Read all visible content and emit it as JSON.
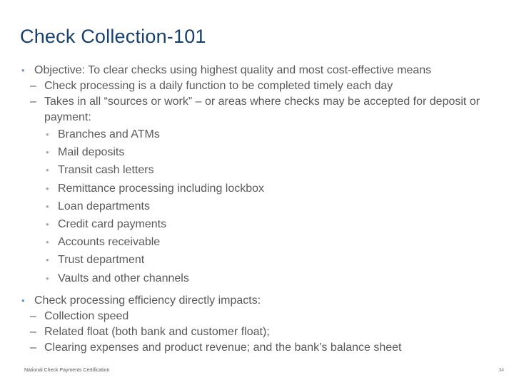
{
  "title": "Check Collection-101",
  "sections": [
    {
      "text": "Objective: To clear checks using highest quality and most cost-effective means",
      "sub": [
        {
          "text": "Check processing is a daily function to be completed timely each day"
        },
        {
          "text": "Takes in all “sources or work” – or areas where checks may be accepted for deposit or payment:",
          "items": [
            "Branches and ATMs",
            "Mail deposits",
            "Transit cash letters",
            "Remittance processing including lockbox",
            "Loan departments",
            "Credit card payments",
            "Accounts receivable",
            "Trust department",
            "Vaults and other channels"
          ]
        }
      ]
    },
    {
      "text": "Check processing efficiency directly impacts:",
      "sub": [
        {
          "text": "Collection speed"
        },
        {
          "text": "Related float (both bank and customer float);"
        },
        {
          "text": "Clearing expenses and product revenue; and the bank’s balance sheet"
        }
      ]
    }
  ],
  "glyphs": {
    "bullet": "•",
    "dash": "–"
  },
  "footer": "National Check Payments Certification",
  "page_number": "34"
}
